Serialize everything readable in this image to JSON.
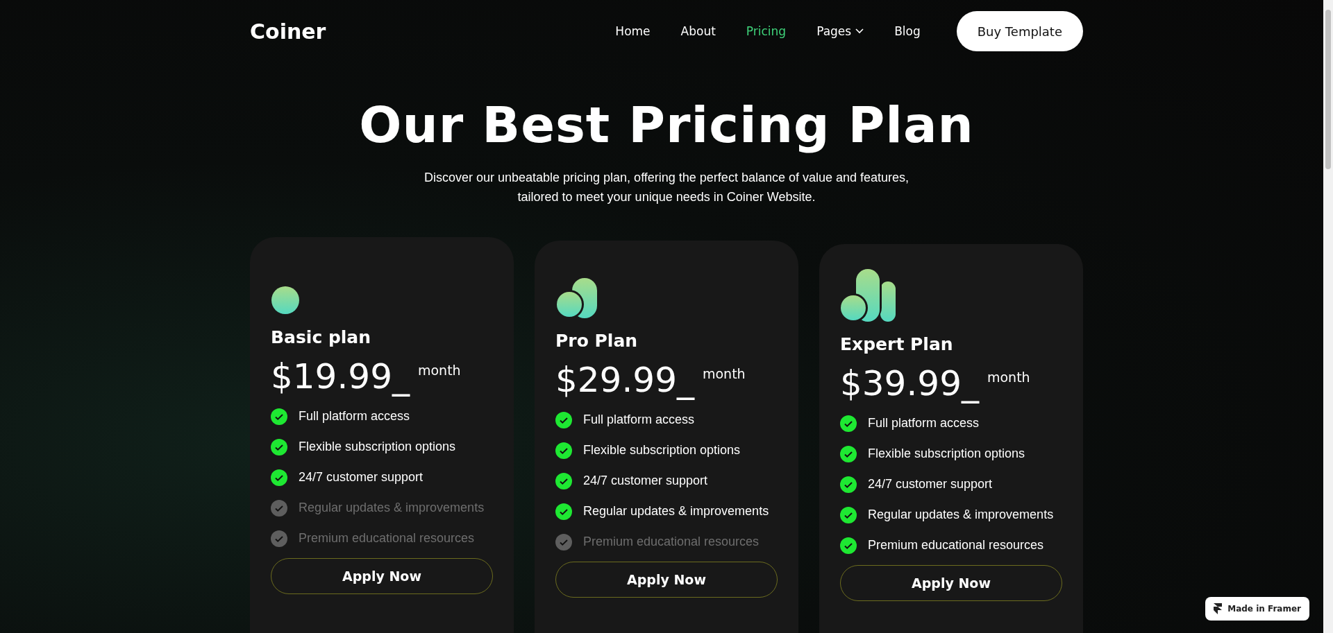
{
  "nav": {
    "logo": "Coiner",
    "links": [
      {
        "label": "Home",
        "selected": false,
        "dropdown": false
      },
      {
        "label": "About",
        "selected": false,
        "dropdown": false
      },
      {
        "label": "Pricing",
        "selected": true,
        "dropdown": false
      },
      {
        "label": "Pages",
        "selected": false,
        "dropdown": true
      },
      {
        "label": "Blog",
        "selected": false,
        "dropdown": false
      }
    ],
    "cta": "Buy Template"
  },
  "hero": {
    "title": "Our Best Pricing Plan",
    "subtitle": "Discover our unbeatable pricing plan, offering the perfect balance of value and features, tailored to meet your unique needs in Coiner Website."
  },
  "plans": [
    {
      "kind": "basic",
      "name": "Basic plan",
      "price": "$19.99_",
      "period": "month",
      "features": [
        {
          "text": "Full platform access",
          "included": true
        },
        {
          "text": "Flexible subscription options",
          "included": true
        },
        {
          "text": "24/7 customer support",
          "included": true
        },
        {
          "text": "Regular updates & improvements",
          "included": false
        },
        {
          "text": "Premium educational resources",
          "included": false
        }
      ],
      "button": "Apply Now"
    },
    {
      "kind": "pro",
      "name": "Pro Plan",
      "price": "$29.99_",
      "period": "month",
      "features": [
        {
          "text": "Full platform access",
          "included": true
        },
        {
          "text": "Flexible subscription options",
          "included": true
        },
        {
          "text": "24/7 customer support",
          "included": true
        },
        {
          "text": "Regular updates & improvements",
          "included": true
        },
        {
          "text": "Premium educational resources",
          "included": false
        }
      ],
      "button": "Apply Now"
    },
    {
      "kind": "expert",
      "name": "Expert Plan",
      "price": "$39.99_",
      "period": "month",
      "features": [
        {
          "text": "Full platform access",
          "included": true
        },
        {
          "text": "Flexible subscription options",
          "included": true
        },
        {
          "text": "24/7 customer support",
          "included": true
        },
        {
          "text": "Regular updates & improvements",
          "included": true
        },
        {
          "text": "Premium educational resources",
          "included": true
        }
      ],
      "button": "Apply Now"
    }
  ],
  "badge": "Made in Framer"
}
